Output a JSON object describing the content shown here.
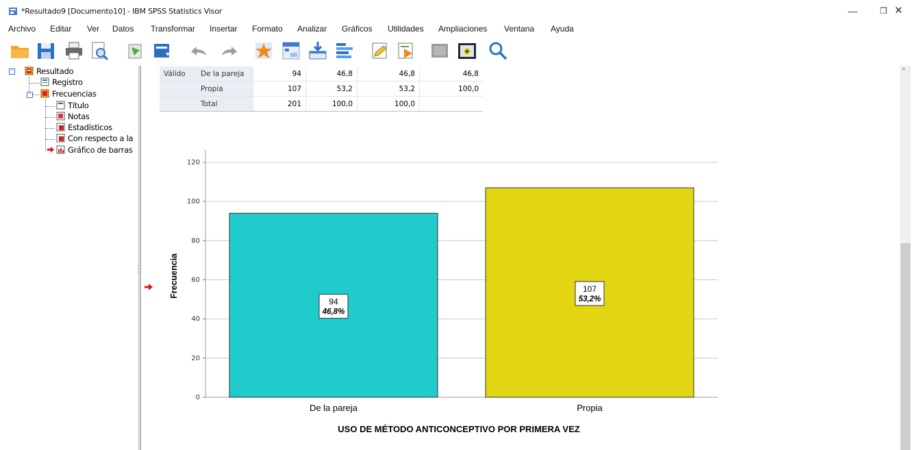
{
  "window": {
    "title": "*Resultado9 [Documento10] - IBM SPSS Statistics Visor",
    "controls": {
      "minimize": "—",
      "restore": "❐",
      "close": "✕"
    }
  },
  "menu": [
    "Archivo",
    "Editar",
    "Ver",
    "Datos",
    "Transformar",
    "Insertar",
    "Formato",
    "Analizar",
    "Gráficos",
    "Utilidades",
    "Ampliaciones",
    "Ventana",
    "Ayuda"
  ],
  "toolbar": {
    "icons": [
      "open-folder-icon",
      "save-icon",
      "print-icon",
      "print-preview-icon",
      "export-icon",
      "recall-dialog-icon",
      "undo-icon",
      "redo-icon",
      "goto-data-icon",
      "goto-case-icon",
      "goto-variable-icon",
      "variables-icon",
      "designate-window-icon",
      "run-script-icon",
      "hide-icon",
      "show-icon",
      "search-icon"
    ]
  },
  "outline": {
    "root": "Resultado",
    "log": "Registro",
    "procedure": "Frecuencias",
    "children": [
      "Título",
      "Notas",
      "Estadísticos",
      "Con respecto a la",
      "Gráfico de barras"
    ]
  },
  "table": {
    "rows": [
      {
        "group": "Válido",
        "label": "De la pareja",
        "freq": "94",
        "pct": "46,8",
        "valid_pct": "46,8",
        "cum_pct": "46,8"
      },
      {
        "group": "",
        "label": "Propia",
        "freq": "107",
        "pct": "53,2",
        "valid_pct": "53,2",
        "cum_pct": "100,0"
      },
      {
        "group": "",
        "label": "Total",
        "freq": "201",
        "pct": "100,0",
        "valid_pct": "100,0",
        "cum_pct": ""
      }
    ]
  },
  "chart_data": {
    "type": "bar",
    "categories": [
      "De la pareja",
      "Propia"
    ],
    "values": [
      94,
      107
    ],
    "data_labels": [
      {
        "count": "94",
        "percent": "46,8%"
      },
      {
        "count": "107",
        "percent": "53,2%"
      }
    ],
    "colors": [
      "#1fcbcb",
      "#e2d512"
    ],
    "title": "",
    "xlabel": "USO DE MÉTODO ANTICONCEPTIVO POR PRIMERA VEZ",
    "ylabel": "Frecuencia",
    "ylim": [
      0,
      120
    ],
    "yticks": [
      0,
      20,
      40,
      60,
      80,
      100,
      120
    ],
    "grid": true
  }
}
